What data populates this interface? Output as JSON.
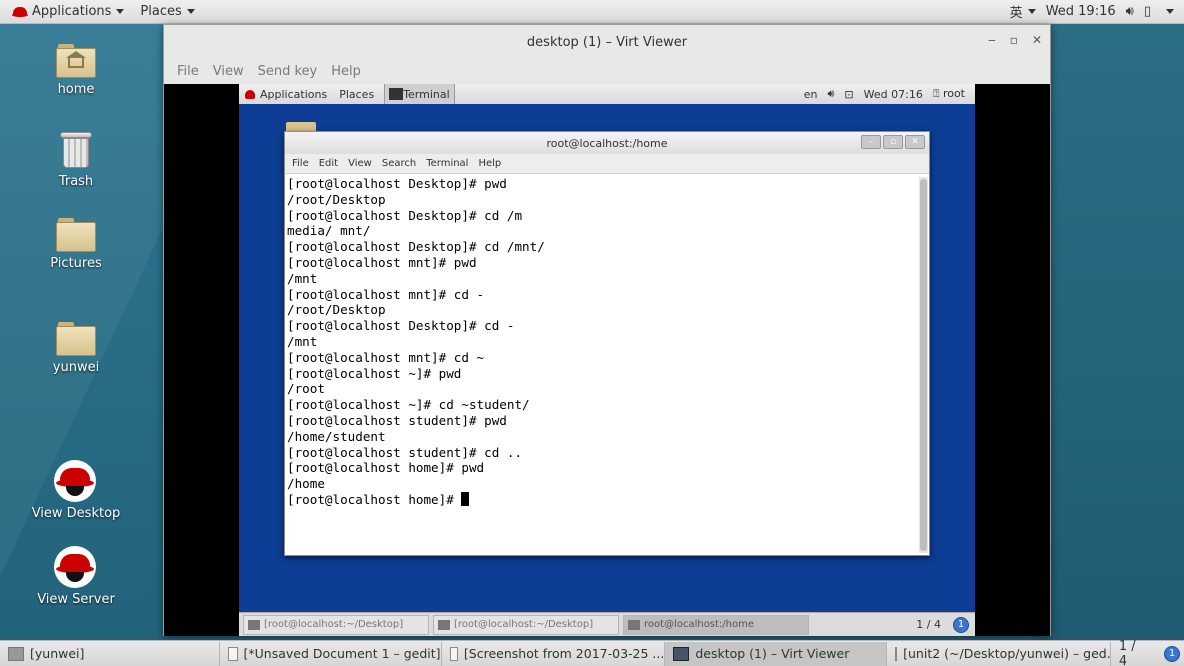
{
  "host_topbar": {
    "applications": "Applications",
    "places": "Places",
    "input_method": "英",
    "clock": "Wed 19:16"
  },
  "desktop_icons": [
    {
      "label": "home"
    },
    {
      "label": "Trash"
    },
    {
      "label": "Pictures"
    },
    {
      "label": "yunwei"
    },
    {
      "label": "View Desktop"
    },
    {
      "label": "View Server"
    }
  ],
  "virt_viewer": {
    "title": "desktop (1) – Virt Viewer",
    "menu": [
      "File",
      "View",
      "Send key",
      "Help"
    ]
  },
  "guest": {
    "topbar": {
      "applications": "Applications",
      "places": "Places",
      "task": "Terminal",
      "lang": "en",
      "clock": "Wed 07:16",
      "user": "root"
    },
    "terminal": {
      "title": "root@localhost:/home",
      "menu": [
        "File",
        "Edit",
        "View",
        "Search",
        "Terminal",
        "Help"
      ],
      "lines": [
        "[root@localhost Desktop]# pwd",
        "/root/Desktop",
        "[root@localhost Desktop]# cd /m",
        "media/ mnt/",
        "[root@localhost Desktop]# cd /mnt/",
        "[root@localhost mnt]# pwd",
        "/mnt",
        "[root@localhost mnt]# cd -",
        "/root/Desktop",
        "[root@localhost Desktop]# cd -",
        "/mnt",
        "[root@localhost mnt]# cd ~",
        "[root@localhost ~]# pwd",
        "/root",
        "[root@localhost ~]# cd ~student/",
        "[root@localhost student]# pwd",
        "/home/student",
        "[root@localhost student]# cd ..",
        "[root@localhost home]# pwd",
        "/home"
      ],
      "prompt": "[root@localhost home]# "
    },
    "taskbar": {
      "tasks": [
        "[root@localhost:~/Desktop]",
        "[root@localhost:~/Desktop]",
        "root@localhost:/home"
      ],
      "pager": "1 / 4",
      "info": "1"
    }
  },
  "host_taskbar": {
    "tasks": [
      "[yunwei]",
      "[*Unsaved Document 1 – gedit]",
      "[Screenshot from 2017-03-25 ...",
      "desktop (1) – Virt Viewer",
      "[unit2 (~/Desktop/yunwei) – ged..."
    ],
    "pager": "1 / 4",
    "info": "1"
  }
}
